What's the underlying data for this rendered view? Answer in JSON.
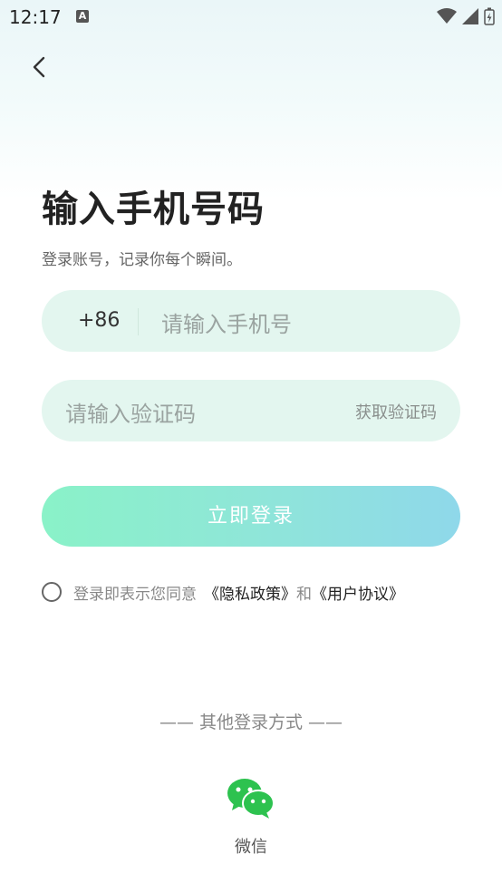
{
  "status_bar": {
    "time": "12:17",
    "notification_icon": "A"
  },
  "header": {
    "back_icon": "chevron-left"
  },
  "title": "输入手机号码",
  "subtitle": "登录账号，记录你每个瞬间。",
  "phone": {
    "country_code": "+86",
    "placeholder": "请输入手机号"
  },
  "code": {
    "placeholder": "请输入验证码",
    "get_code_label": "获取验证码"
  },
  "login_button": "立即登录",
  "agreement": {
    "prefix": "登录即表示您同意",
    "privacy": "《隐私政策》",
    "and": "和",
    "terms": "《用户协议》"
  },
  "other_login": {
    "title": "—— 其他登录方式 ——",
    "wechat_label": "微信"
  },
  "colors": {
    "field_bg": "#e3f6ef",
    "button_start": "#8af2c8",
    "button_end": "#8fd8ea",
    "wechat": "#2dc24f"
  }
}
